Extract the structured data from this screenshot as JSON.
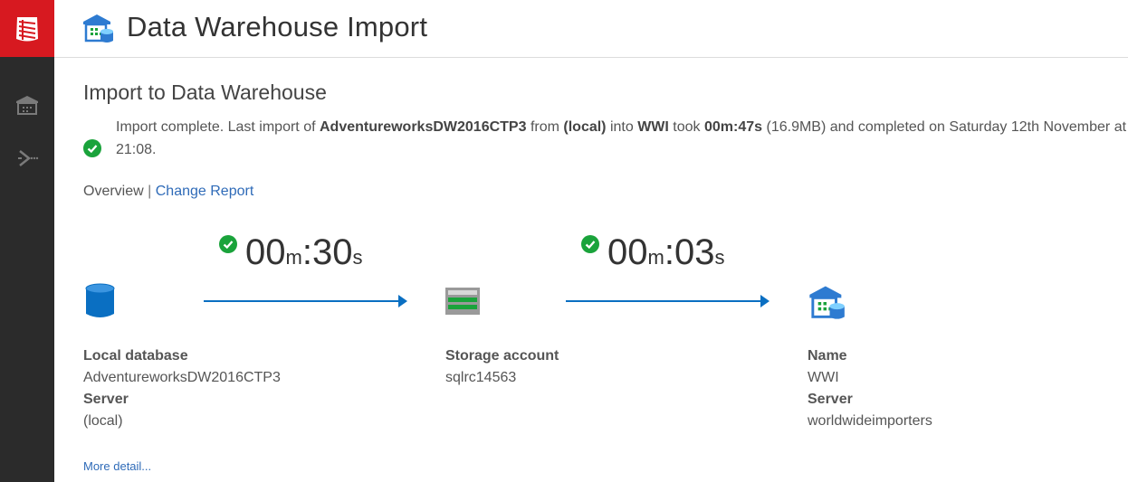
{
  "header": {
    "title": "Data Warehouse Import"
  },
  "sidebar": {
    "icons": [
      "database-logo-icon",
      "warehouse-icon",
      "deploy-icon"
    ]
  },
  "main": {
    "section_title": "Import to Data Warehouse",
    "status": {
      "p1": "Import complete. Last import of ",
      "source_db": "AdventureworksDW2016CTP3",
      "p2": " from ",
      "source_server": "(local)",
      "p3": " into ",
      "target": "WWI",
      "p4": " took ",
      "duration": "00m:47s",
      "p5": " (16.9MB) and completed on Saturday 12th November at 21:08."
    },
    "views": {
      "overview": "Overview",
      "separator": "|",
      "change_report": "Change Report"
    },
    "timers": [
      {
        "min": "00",
        "m": "m",
        "colon": ":",
        "sec": "30",
        "s": "s"
      },
      {
        "min": "00",
        "m": "m",
        "colon": ":",
        "sec": "03",
        "s": "s"
      }
    ],
    "source": {
      "label1": "Local database",
      "value1": "AdventureworksDW2016CTP3",
      "label2": "Server",
      "value2": "(local)"
    },
    "storage": {
      "label1": "Storage account",
      "value1": "sqlrc14563"
    },
    "destination": {
      "label1": "Name",
      "value1": "WWI",
      "label2": "Server",
      "value2": "worldwideimporters"
    },
    "more_detail": "More detail..."
  },
  "colors": {
    "brand_red": "#d71920",
    "sidebar": "#2b2b2b",
    "accent_blue": "#0a6fc2",
    "link": "#2f6bb8",
    "success_green": "#1aa33b"
  }
}
